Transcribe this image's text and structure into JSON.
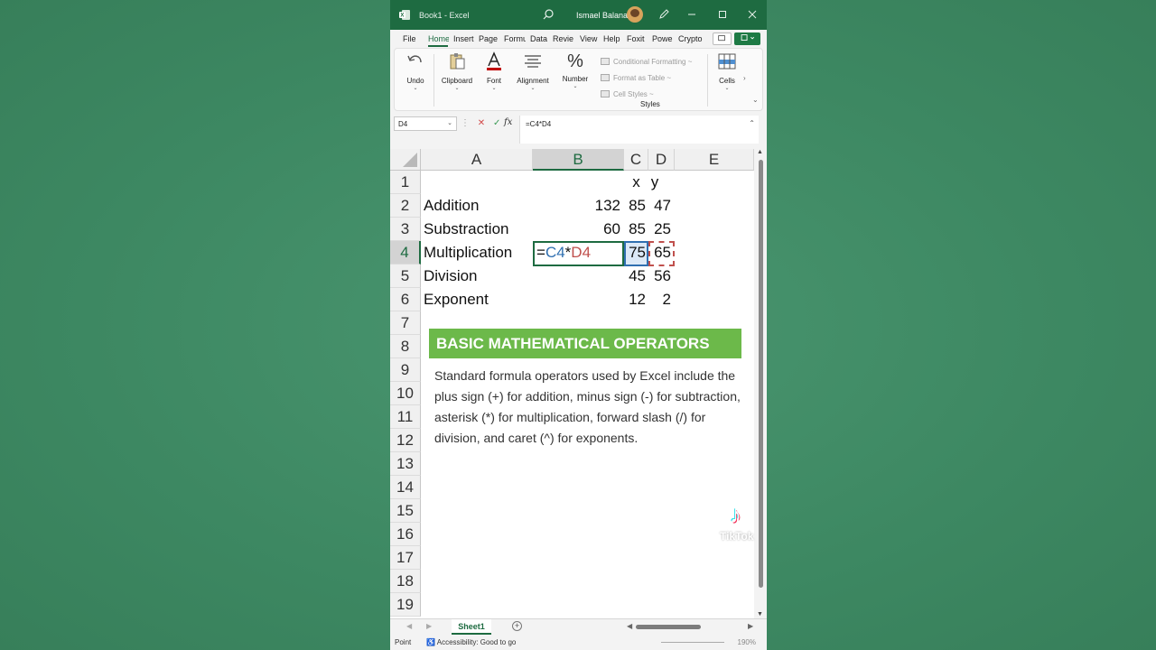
{
  "titlebar": {
    "title": "Book1 - Excel",
    "user": "Ismael Balana",
    "icons": [
      "excel-logo-icon",
      "search-icon",
      "pen-icon",
      "minimize-icon",
      "maximize-icon",
      "close-icon"
    ]
  },
  "tabs": [
    "File",
    "Home",
    "Insert",
    "Page",
    "Formu",
    "Data",
    "Revie",
    "View",
    "Help",
    "Foxit",
    "Powe",
    "Crypto"
  ],
  "ribbon": {
    "undo": "Undo",
    "clipboard": "Clipboard",
    "font": "Font",
    "alignment": "Alignment",
    "number": "Number",
    "conditional_formatting": "Conditional Formatting ~",
    "format_as_table": "Format as Table ~",
    "cell_styles": "Cell Styles ~",
    "styles_group": "Styles",
    "cells": "Cells"
  },
  "formula_bar": {
    "name_box": "D4",
    "formula": "=C4*D4",
    "fx": "fx"
  },
  "grid": {
    "columns": [
      "A",
      "B",
      "C",
      "D",
      "E"
    ],
    "rows": [
      "1",
      "2",
      "3",
      "4",
      "5",
      "6",
      "7",
      "8",
      "9",
      "10",
      "11",
      "12",
      "13",
      "14",
      "15",
      "16",
      "17",
      "18",
      "19"
    ],
    "header_x": "x",
    "header_y": "y",
    "data": [
      {
        "label": "Addition",
        "result": "132",
        "x": "85",
        "y": "47"
      },
      {
        "label": "Substraction",
        "result": "60",
        "x": "85",
        "y": "25"
      },
      {
        "label": "Multiplication",
        "result": "",
        "x": "75",
        "y": "65"
      },
      {
        "label": "Division",
        "result": "",
        "x": "45",
        "y": "56"
      },
      {
        "label": "Exponent",
        "result": "",
        "x": "12",
        "y": "2"
      }
    ],
    "editing": {
      "eq": "=",
      "ref1": "C4",
      "op": "*",
      "ref2": "D4"
    }
  },
  "overlay": {
    "title": "BASIC MATHEMATICAL OPERATORS",
    "body": "Standard formula operators used by Excel include the plus sign (+) for addition,  minus sign (-) for subtraction, asterisk (*) for multiplication, forward slash (/) for division, and caret (^) for exponents."
  },
  "sheet_tab": "Sheet1",
  "status": {
    "mode": "Point",
    "accessibility": "Accessibility: Good to go",
    "zoom": "190%"
  },
  "watermark": {
    "brand": "TikTok",
    "handle": "@ismaelmasbalana"
  },
  "colors": {
    "excel_green": "#1e6b41",
    "banner_green": "#6cb94a",
    "ref_blue": "#2f6fb0",
    "ref_red": "#c0504d",
    "background": "#3e8a63"
  }
}
